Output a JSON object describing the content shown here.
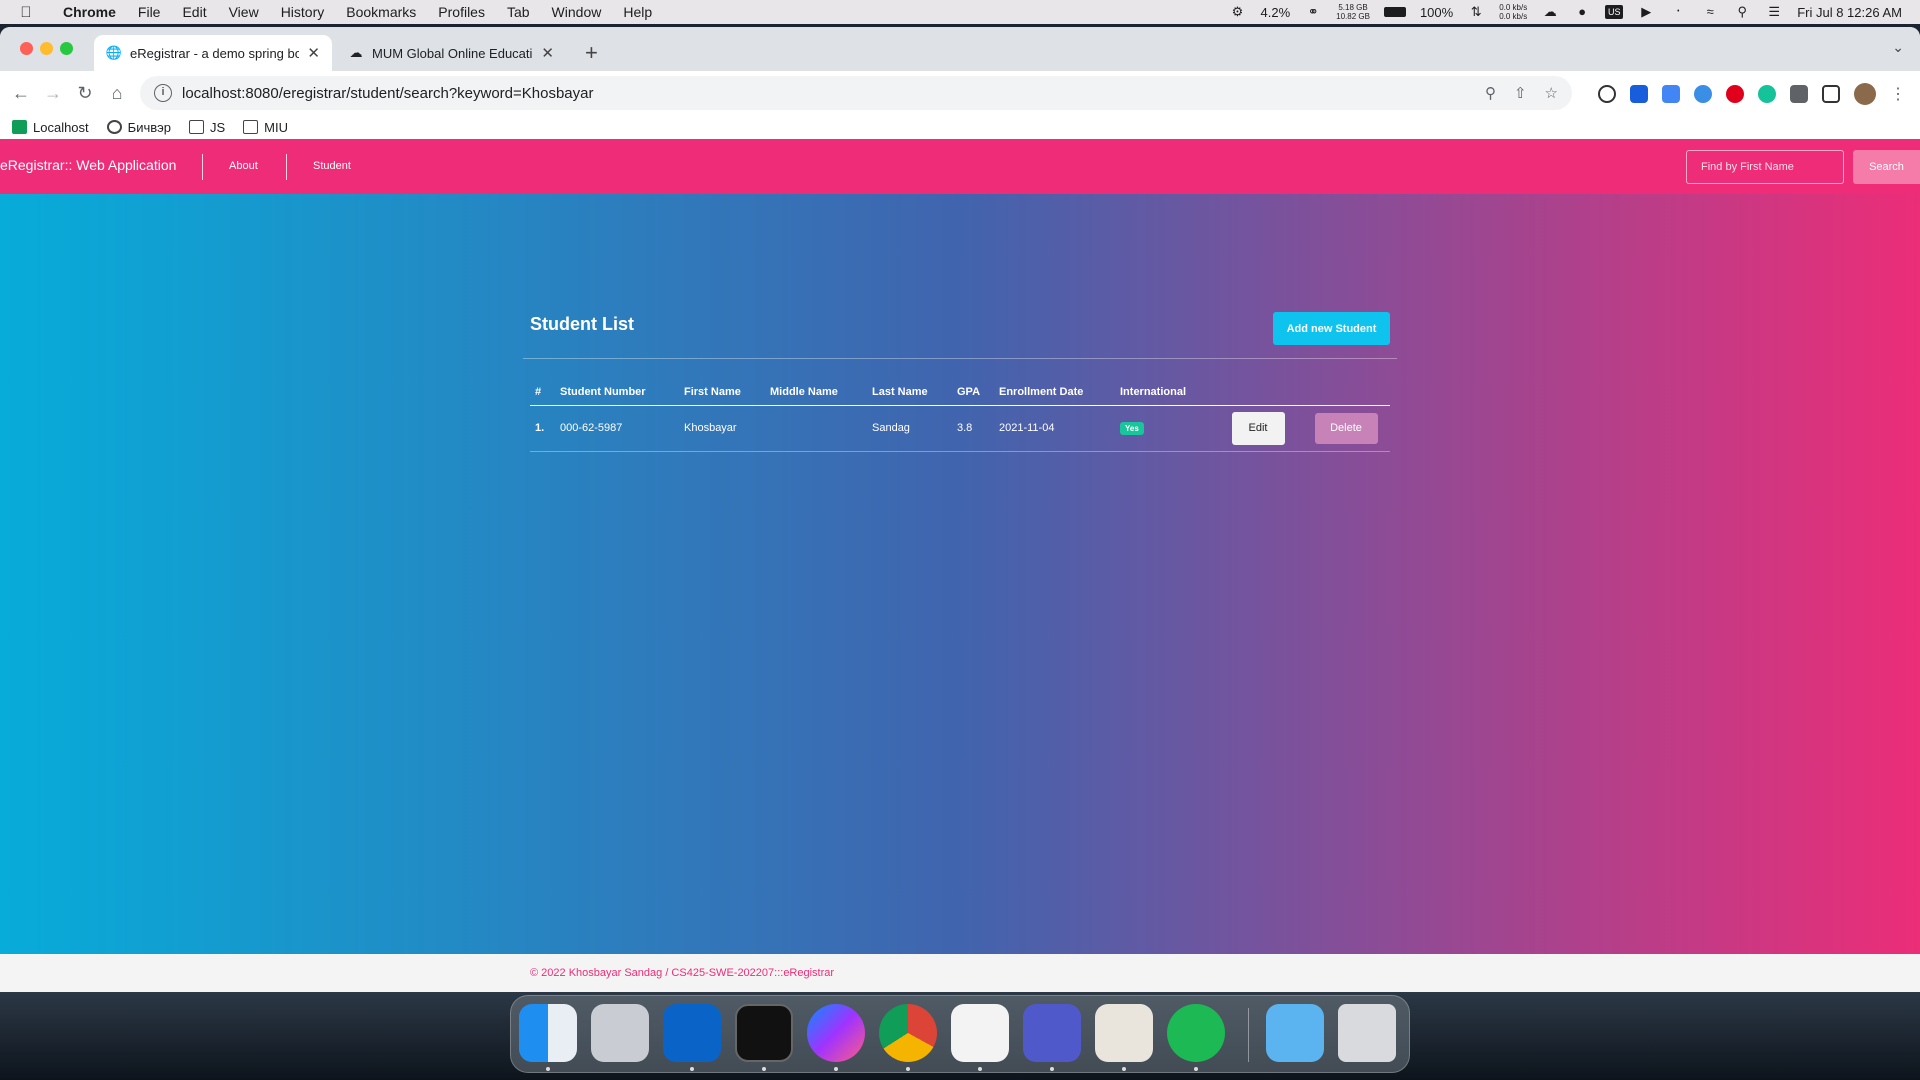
{
  "menubar": {
    "app_name": "Chrome",
    "items": [
      "File",
      "Edit",
      "View",
      "History",
      "Bookmarks",
      "Profiles",
      "Tab",
      "Window",
      "Help"
    ],
    "cpu": "4.2%",
    "mem_top": "5.18 GB",
    "mem_bottom": "10.82 GB",
    "battery": "100%",
    "net_up": "0.0 kb/s",
    "net_down": "0.0 kb/s",
    "datetime": "Fri Jul 8  12:26 AM"
  },
  "browser": {
    "tabs": [
      {
        "title": "eRegistrar - a demo spring boo",
        "active": true
      },
      {
        "title": "MUM Global Online Education",
        "active": false
      }
    ],
    "url": "localhost:8080/eregistrar/student/search?keyword=Khosbayar",
    "bookmarks": [
      "Localhost",
      "Бичвэр",
      "JS",
      "MIU"
    ]
  },
  "app": {
    "brand": "eRegistrar:: Web Application",
    "nav": {
      "about": "About",
      "student": "Student"
    },
    "search": {
      "placeholder": "Find by First Name",
      "button": "Search"
    },
    "page_title": "Student List",
    "add_button": "Add new Student",
    "table": {
      "headers": [
        "#",
        "Student Number",
        "First Name",
        "Middle Name",
        "Last Name",
        "GPA",
        "Enrollment Date",
        "International"
      ],
      "rows": [
        {
          "index": "1.",
          "student_number": "000-62-5987",
          "first_name": "Khosbayar",
          "middle_name": "",
          "last_name": "Sandag",
          "gpa": "3.8",
          "enrollment_date": "2021-11-04",
          "international": "Yes",
          "edit": "Edit",
          "delete": "Delete"
        }
      ]
    },
    "footer": "© 2022 Khosbayar Sandag / CS425-SWE-202207:::eRegistrar"
  },
  "colors": {
    "nav_pink": "#ef2c78",
    "gradient_left": "#07acd9",
    "gradient_mid": "#4164ae",
    "gradient_right": "#ec2d78",
    "add_button": "#0fc3ef",
    "badge_green": "#19c59a"
  },
  "dock": {
    "apps": [
      "Finder",
      "Launchpad",
      "Outlook",
      "Terminal",
      "Messenger",
      "Chrome",
      "Visual Studio Code",
      "Teams",
      "TablePlus",
      "Spotify",
      "Downloads",
      "Trash"
    ]
  }
}
